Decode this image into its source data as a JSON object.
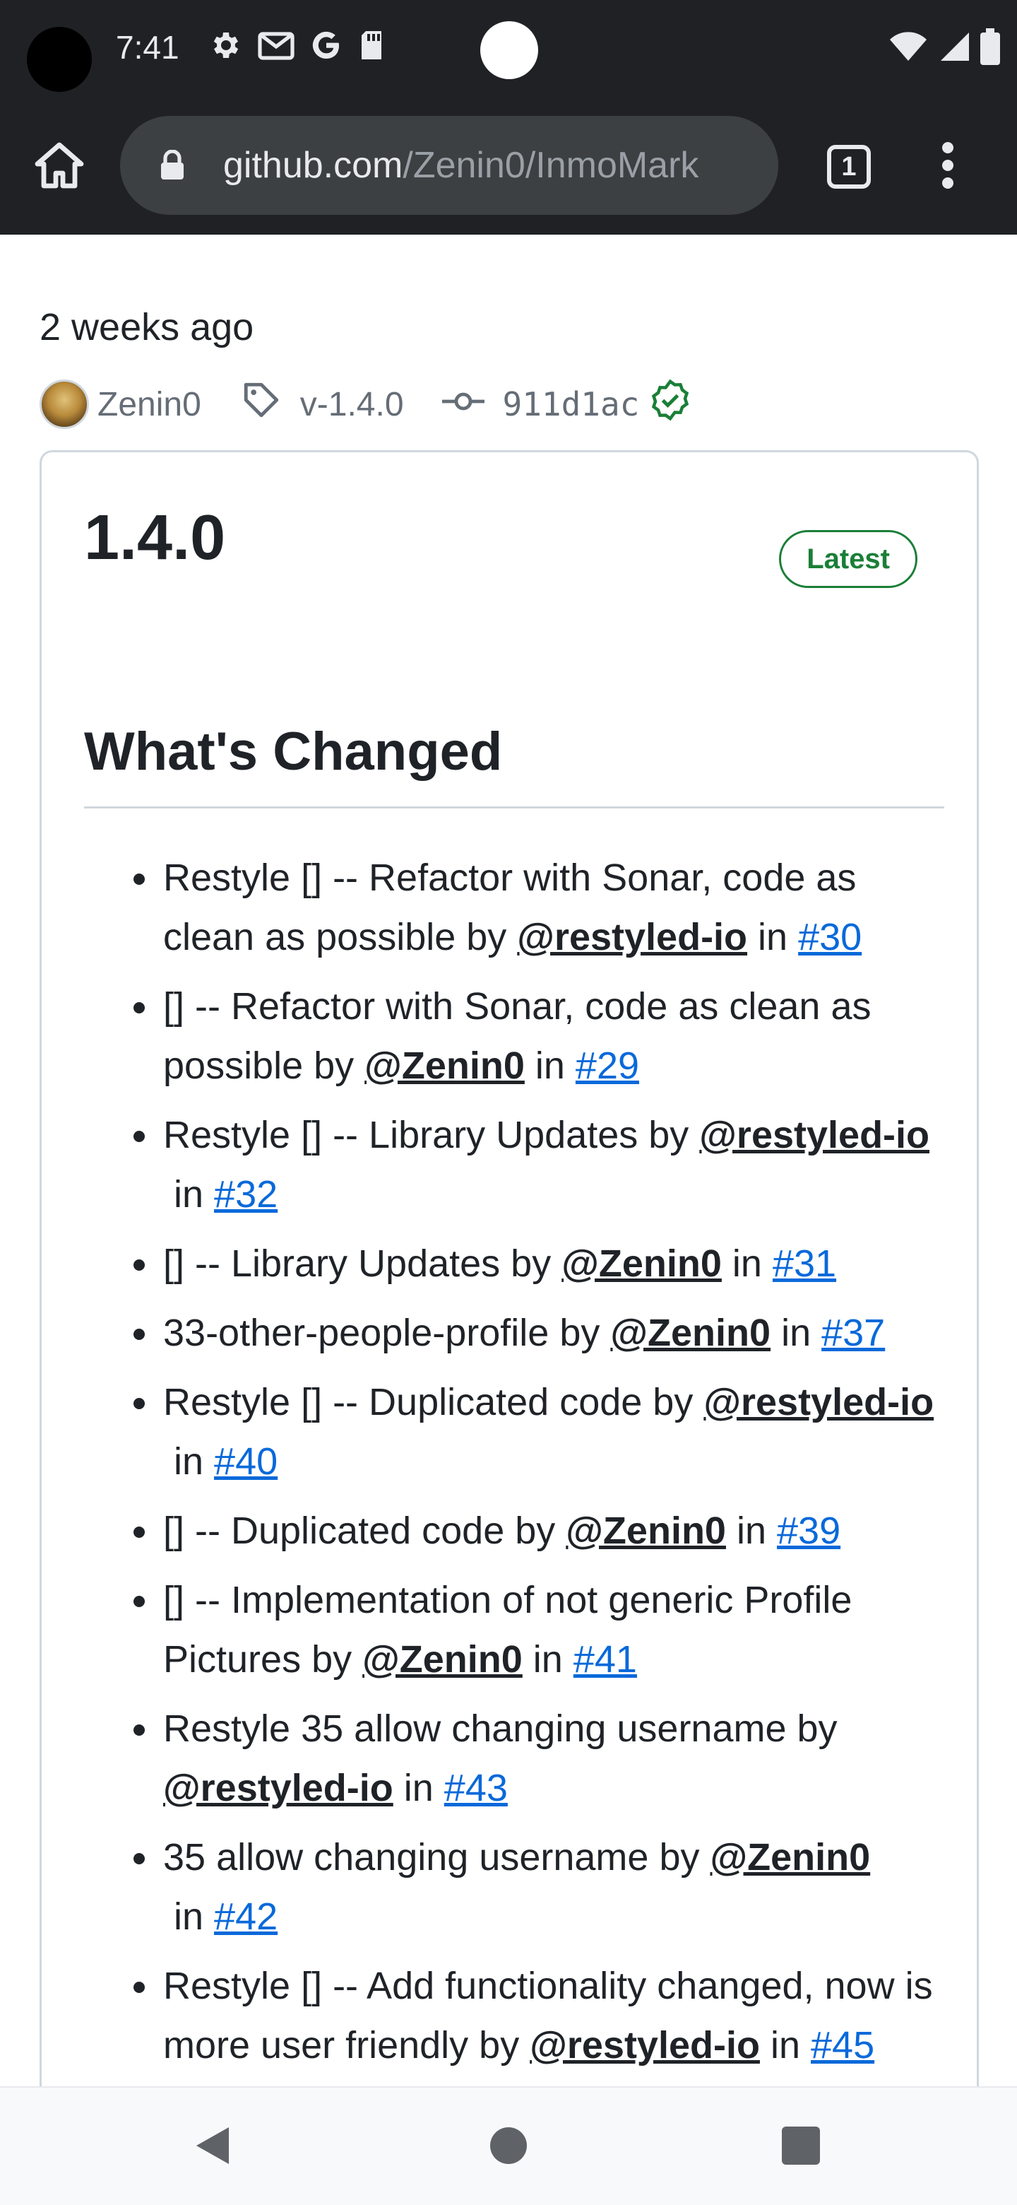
{
  "status_bar": {
    "time": "7:41",
    "left_icons": [
      "gear-icon",
      "gmail-icon",
      "google-icon",
      "sd-card-icon"
    ],
    "right_icons": [
      "wifi-icon",
      "signal-icon",
      "battery-icon"
    ]
  },
  "browser": {
    "url_host": "github.com",
    "url_path": "/Zenin0/InmoMark",
    "tab_count": "1"
  },
  "release": {
    "released": "2 weeks ago",
    "author": "Zenin0",
    "tag": "v-1.4.0",
    "commit": "911d1ac",
    "title": "1.4.0",
    "badge": "Latest",
    "section_heading": "What's Changed",
    "changes": [
      {
        "text": "Restyle [] -- Refactor with Sonar, code as clean as possible by ",
        "author": "@restyled-io",
        "in": " in ",
        "pr": "#30"
      },
      {
        "text": "[] -- Refactor with Sonar, code as clean as possible by ",
        "author": "@Zenin0",
        "in": " in ",
        "pr": "#29"
      },
      {
        "text": "Restyle [] -- Library Updates by ",
        "author": "@restyled-io",
        "in": " in ",
        "pr": "#32"
      },
      {
        "text": "[] -- Library Updates by ",
        "author": "@Zenin0",
        "in": " in ",
        "pr": "#31"
      },
      {
        "text": "33-other-people-profile by ",
        "author": "@Zenin0",
        "in": " in ",
        "pr": "#37"
      },
      {
        "text": "Restyle [] -- Duplicated code by ",
        "author": "@restyled-io",
        "in": " in ",
        "pr": "#40"
      },
      {
        "text": "[] -- Duplicated code by ",
        "author": "@Zenin0",
        "in": " in ",
        "pr": "#39"
      },
      {
        "text": "[] -- Implementation of not generic Profile Pictures by ",
        "author": "@Zenin0",
        "in": " in ",
        "pr": "#41"
      },
      {
        "text": "Restyle 35 allow changing username by ",
        "author": "@restyled-io",
        "in": " in ",
        "pr": "#43"
      },
      {
        "text": "35 allow changing username by ",
        "author": "@Zenin0",
        "in": " in ",
        "pr": "#42"
      },
      {
        "text": "Restyle [] -- Add functionality changed, now is more user friendly by ",
        "author": "@restyled-io",
        "in": " in ",
        "pr": "#45"
      }
    ]
  },
  "colors": {
    "chrome_bg": "#202124",
    "url_pill_bg": "#3c4043",
    "link": "#0969da",
    "latest_green": "#1a7f37",
    "border": "#d0d7de"
  },
  "nav_bar": {
    "icons": [
      "back-icon",
      "home-circle-icon",
      "recents-icon"
    ]
  }
}
